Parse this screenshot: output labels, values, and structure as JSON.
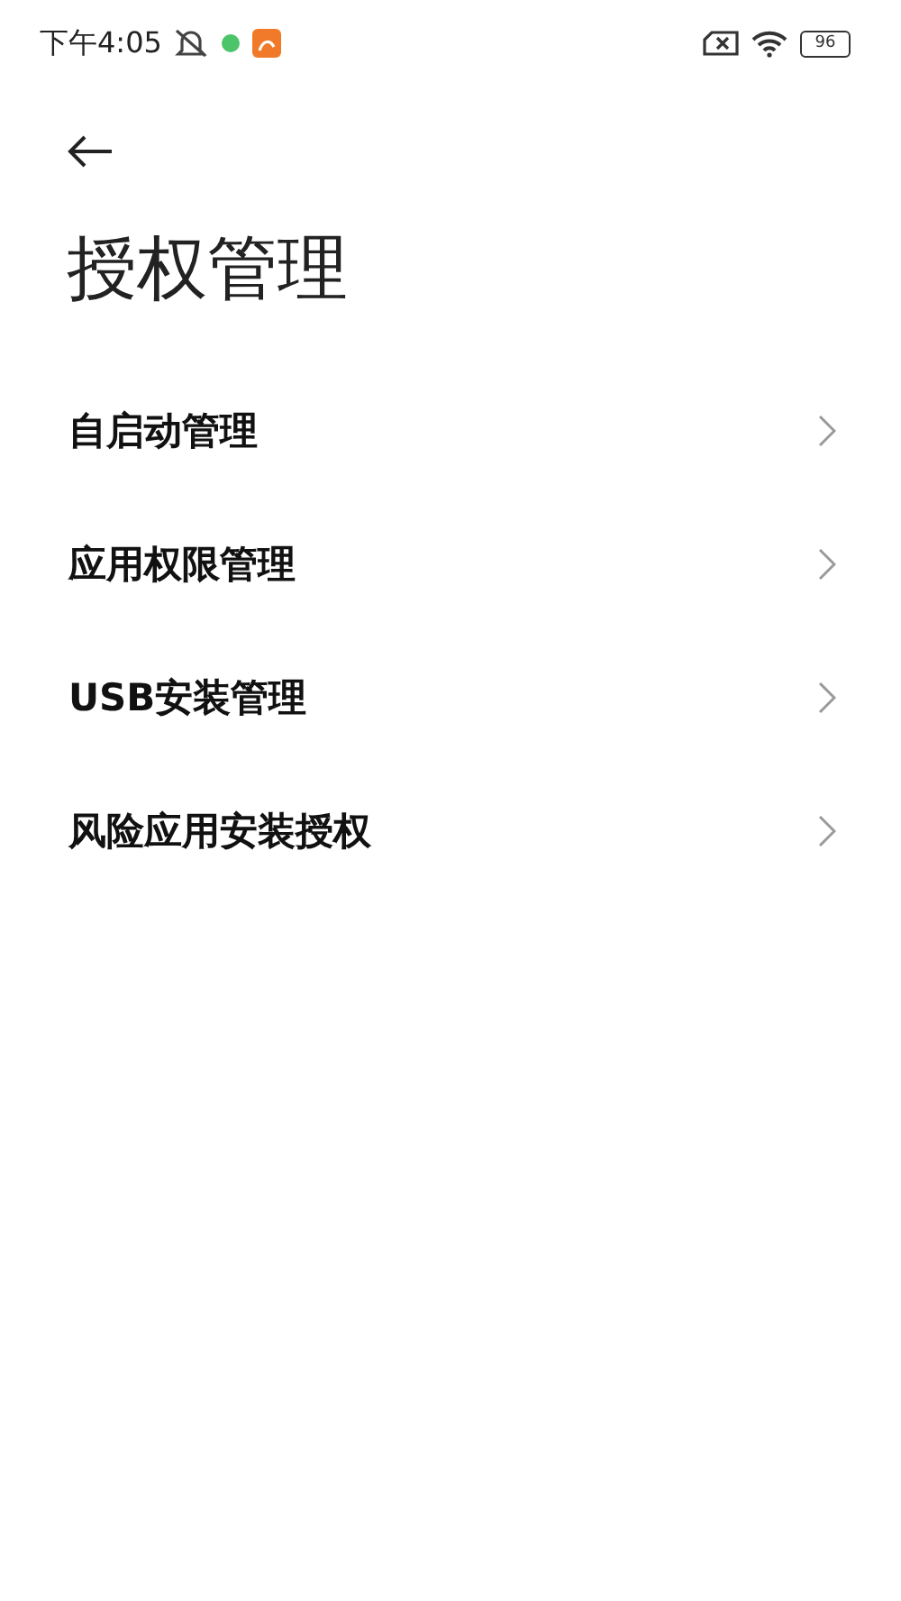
{
  "status_bar": {
    "time": "下午4:05",
    "battery": "96"
  },
  "title": "授权管理",
  "items": [
    {
      "label": "自启动管理"
    },
    {
      "label": "应用权限管理"
    },
    {
      "label": "USB安装管理"
    },
    {
      "label": "风险应用安装授权"
    }
  ]
}
